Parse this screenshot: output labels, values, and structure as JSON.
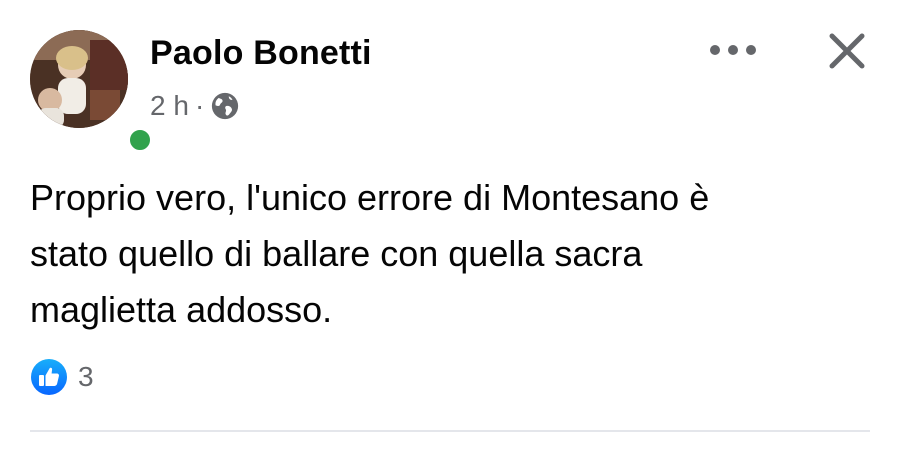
{
  "author": {
    "name": "Paolo Bonetti",
    "online": true
  },
  "meta": {
    "time": "2 h",
    "separator": "·",
    "audience_icon": "globe-icon"
  },
  "actions": {
    "more_icon": "more-dots-icon",
    "close_icon": "close-icon"
  },
  "post": {
    "text": "Proprio vero, l'unico errore di Montesano è\nstato quello di ballare con quella sacra\nmaglietta addosso."
  },
  "reactions": {
    "icon": "like-icon",
    "count": "3"
  },
  "colors": {
    "online": "#31a24c",
    "like": "#1877f2",
    "secondary_text": "#65676b",
    "primary_text": "#050505"
  }
}
